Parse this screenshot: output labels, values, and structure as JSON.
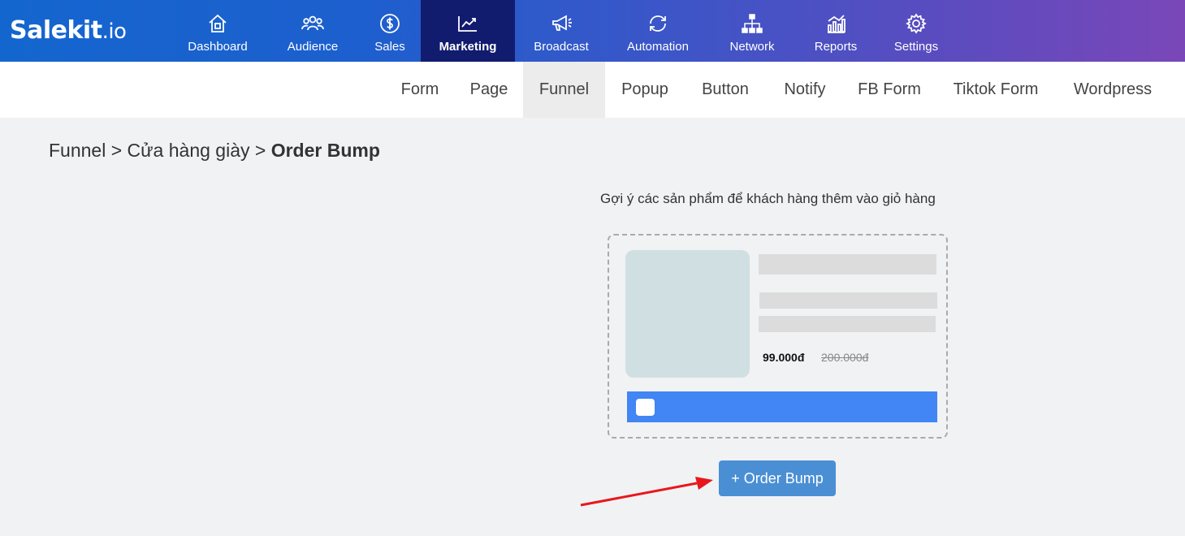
{
  "logo": {
    "main": "Salekit",
    "suffix": ".io"
  },
  "nav": [
    {
      "label": "Dashboard",
      "icon": "home-icon"
    },
    {
      "label": "Audience",
      "icon": "users-icon"
    },
    {
      "label": "Sales",
      "icon": "dollar-icon"
    },
    {
      "label": "Marketing",
      "icon": "chart-icon",
      "active": true
    },
    {
      "label": "Broadcast",
      "icon": "megaphone-icon"
    },
    {
      "label": "Automation",
      "icon": "refresh-icon"
    },
    {
      "label": "Network",
      "icon": "sitemap-icon"
    },
    {
      "label": "Reports",
      "icon": "bar-chart-icon"
    },
    {
      "label": "Settings",
      "icon": "gear-icon"
    }
  ],
  "subnav": [
    "Form",
    "Page",
    "Funnel",
    "Popup",
    "Button",
    "Notify",
    "FB Form",
    "Tiktok Form",
    "Wordpress"
  ],
  "breadcrumb": {
    "part1": "Funnel",
    "sep": ">",
    "part2": "Cửa hàng giày",
    "current": "Order Bump"
  },
  "hint": "Gợi ý các sản phẩm để khách hàng thêm vào giỏ hàng",
  "preview": {
    "price": "99.000đ",
    "old_price": "200.000đ"
  },
  "add_button": "+ Order Bump",
  "colors": {
    "active_nav": "#121c6e",
    "button": "#4a8fd4",
    "preview_bar": "#4285f4",
    "arrow": "#e8171c"
  }
}
